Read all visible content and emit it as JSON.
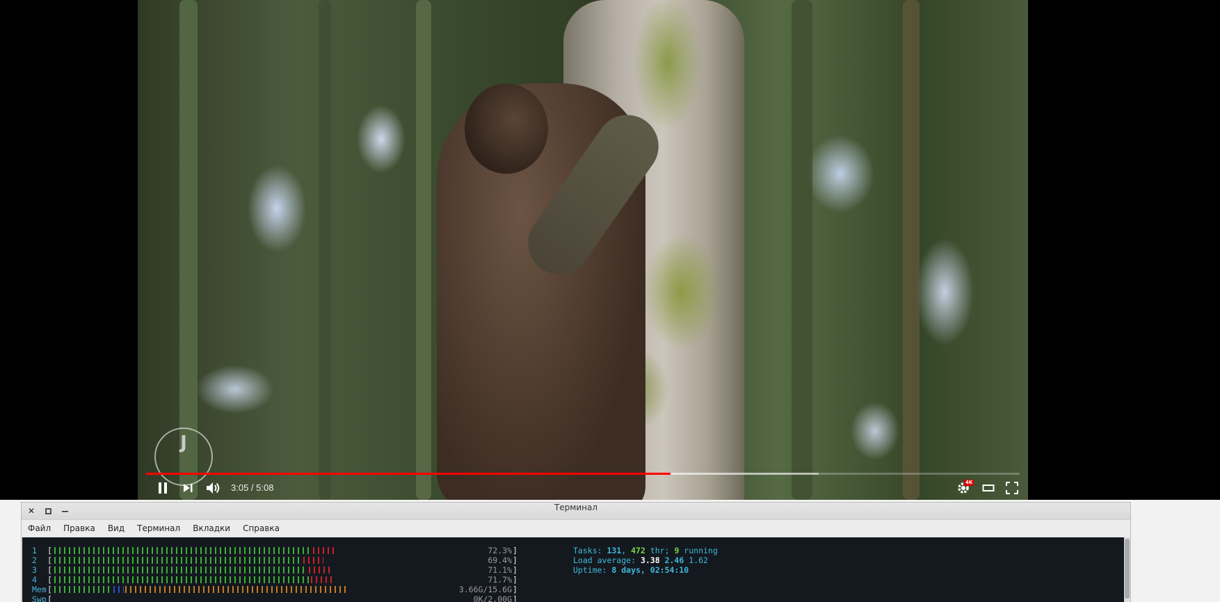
{
  "player": {
    "time_current": "3:05",
    "time_sep": " / ",
    "time_total": "5:08",
    "played_fraction": 0.6,
    "buffered_fraction": 0.77,
    "quality_badge": "4K",
    "watermark_letter": "J",
    "colors": {
      "progress": "#ff0000"
    },
    "icons": [
      "pause-icon",
      "next-icon",
      "volume-icon",
      "settings-icon",
      "theater-icon",
      "fullscreen-icon"
    ]
  },
  "terminal": {
    "title": "Терминал",
    "menu": [
      "Файл",
      "Правка",
      "Вид",
      "Терминал",
      "Вкладки",
      "Справка"
    ],
    "meters": [
      {
        "label": "1",
        "value": "72.3%",
        "fill": 0.723
      },
      {
        "label": "2",
        "value": "69.4%",
        "fill": 0.694
      },
      {
        "label": "3",
        "value": "71.1%",
        "fill": 0.711
      },
      {
        "label": "4",
        "value": "71.7%",
        "fill": 0.717
      },
      {
        "label": "Mem",
        "value": "3.66G/15.6G",
        "fill": 0.76
      },
      {
        "label": "Swp",
        "value": "0K/2.00G",
        "fill": 0.0
      }
    ],
    "tasks": {
      "prefix": "Tasks: ",
      "tasks": "131",
      "sep1": ", ",
      "threads": "472",
      "thr_label": " thr; ",
      "running": "9",
      "running_label": " running"
    },
    "load": {
      "prefix": "Load average: ",
      "l1": "3.38",
      "l5": "2.46",
      "l15": "1.62"
    },
    "uptime": {
      "prefix": "Uptime: ",
      "value": "8 days, 02:54:10"
    },
    "colors": {
      "background": "#14191f",
      "bar_green": "#3fae3a",
      "bar_red": "#c8202a",
      "bar_blue": "#2a50c8",
      "bar_orange": "#c87a20"
    }
  }
}
